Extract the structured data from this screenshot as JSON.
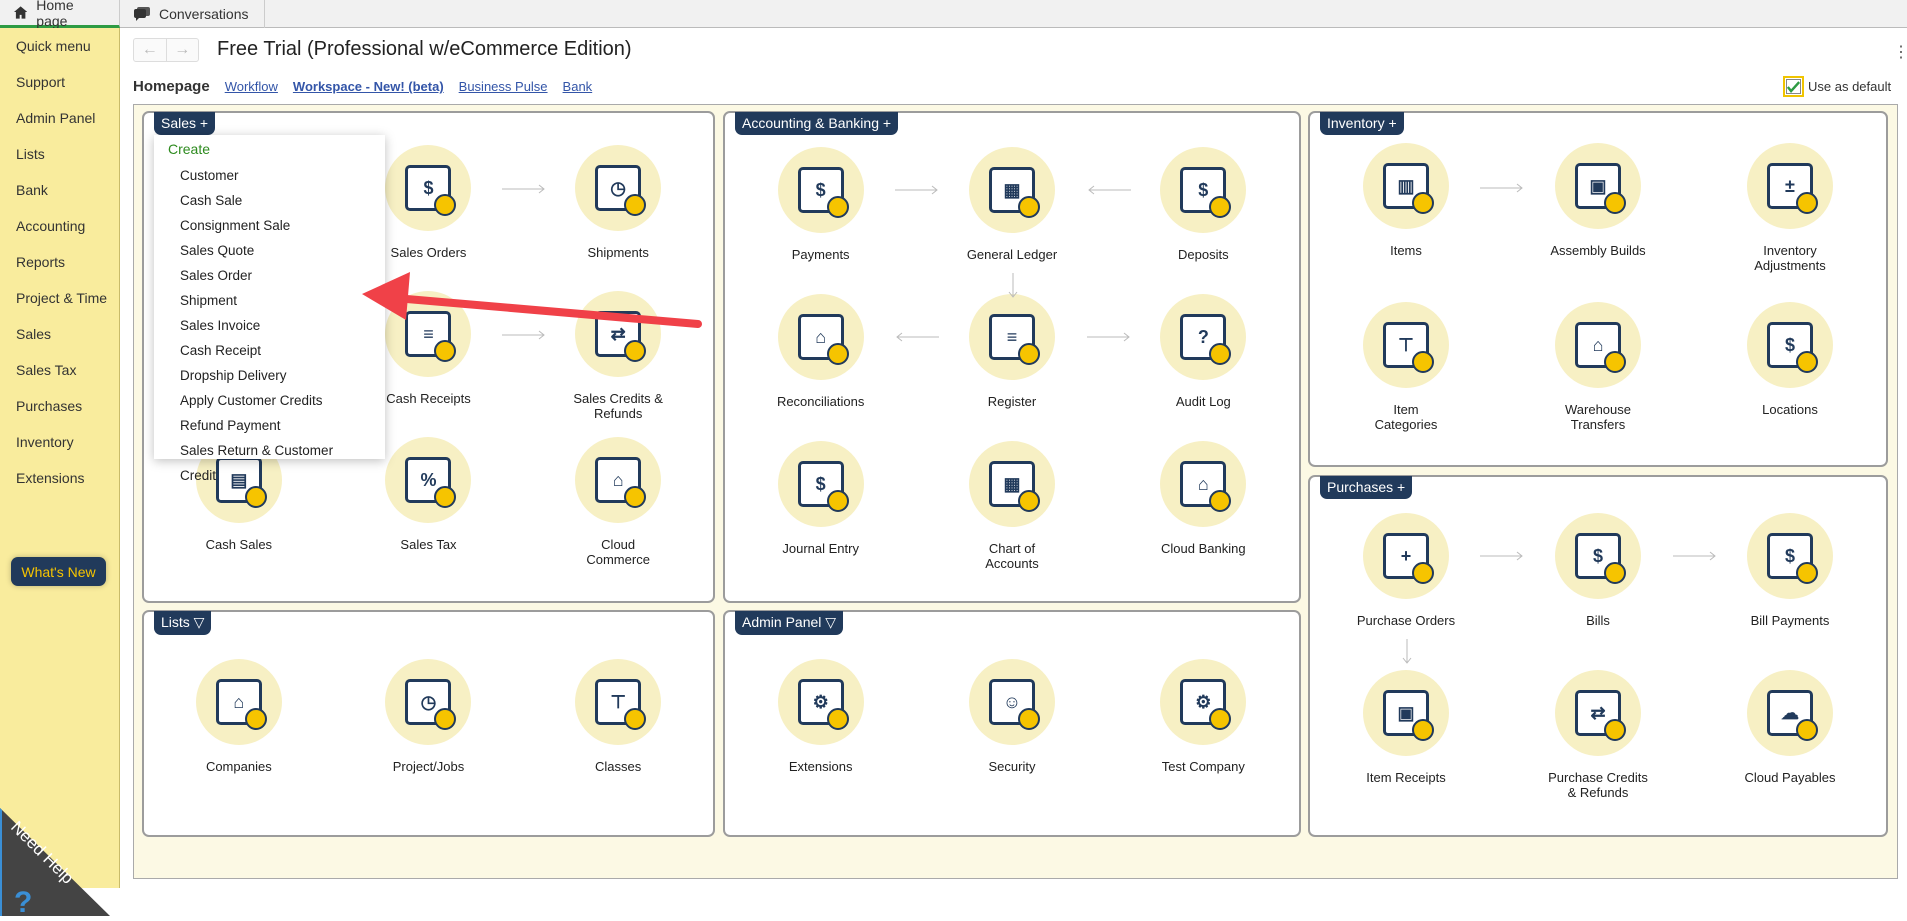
{
  "tabs": [
    {
      "label": "Home page",
      "icon": "home-icon"
    },
    {
      "label": "Conversations",
      "icon": "chat-icon"
    }
  ],
  "sidebar": {
    "items": [
      "Quick menu",
      "Support",
      "Admin Panel",
      "Lists",
      "Bank",
      "Accounting",
      "Reports",
      "Project & Time",
      "Sales",
      "Sales Tax",
      "Purchases",
      "Inventory",
      "Extensions"
    ],
    "whats_new": "What's New",
    "need_help": "Need Help"
  },
  "header": {
    "title": "Free Trial (Professional w/eCommerce Edition)",
    "home": "Homepage",
    "links": [
      "Workflow",
      "Workspace - New! (beta)",
      "Business Pulse",
      "Bank"
    ],
    "use_default": "Use as default",
    "use_default_checked": true
  },
  "panels": {
    "sales": {
      "title": "Sales +",
      "tiles": [
        "",
        "Sales Orders",
        "Shipments",
        "",
        "Cash Receipts",
        "Sales Credits & Refunds",
        "Cash Sales",
        "Sales Tax",
        "Cloud Commerce"
      ]
    },
    "accounting": {
      "title": "Accounting & Banking +",
      "tiles": [
        "Payments",
        "General Ledger",
        "Deposits",
        "Reconciliations",
        "Register",
        "Audit Log",
        "Journal Entry",
        "Chart of Accounts",
        "Cloud Banking"
      ]
    },
    "inventory": {
      "title": "Inventory +",
      "tiles": [
        "Items",
        "Assembly Builds",
        "Inventory Adjustments",
        "Item Categories",
        "Warehouse Transfers",
        "Locations"
      ]
    },
    "purchases": {
      "title": "Purchases +",
      "tiles": [
        "Purchase Orders",
        "Bills",
        "Bill Payments",
        "Item Receipts",
        "Purchase Credits & Refunds",
        "Cloud Payables"
      ]
    },
    "lists": {
      "title": "Lists ▽",
      "tiles": [
        "Companies",
        "Project/Jobs",
        "Classes"
      ]
    },
    "admin": {
      "title": "Admin Panel ▽",
      "tiles": [
        "Extensions",
        "Security",
        "Test Company"
      ]
    }
  },
  "dropdown": {
    "header": "Create",
    "items": [
      "Customer",
      "Cash Sale",
      "Consignment Sale",
      "Sales Quote",
      "Sales Order",
      "Shipment",
      "Sales Invoice",
      "Cash Receipt",
      "Dropship Delivery",
      "Apply Customer Credits",
      "Refund Payment",
      "Sales Return & Customer Credit"
    ]
  },
  "colors": {
    "sidebar": "#f9ec9d",
    "navy": "#213a5b",
    "accent": "#f6c400",
    "annotation": "#f04148"
  }
}
